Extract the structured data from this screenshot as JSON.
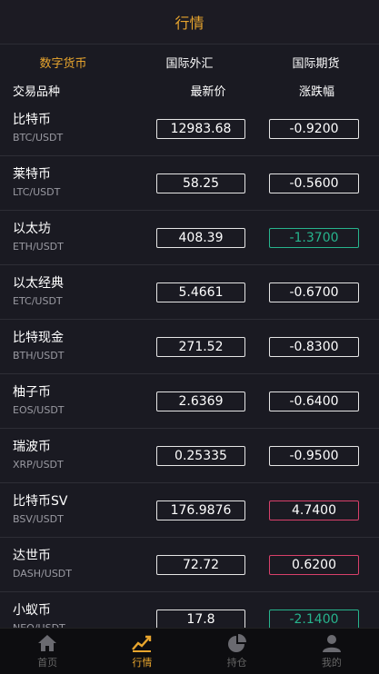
{
  "header": {
    "title": "行情"
  },
  "tabs": [
    {
      "label": "数字货币",
      "active": true
    },
    {
      "label": "国际外汇",
      "active": false
    },
    {
      "label": "国际期货",
      "active": false
    }
  ],
  "columns": {
    "name": "交易品种",
    "price": "最新价",
    "change": "涨跌幅"
  },
  "rows": [
    {
      "name": "比特币",
      "pair": "BTC/USDT",
      "price": "12983.68",
      "change": "-0.9200",
      "trend": "flat"
    },
    {
      "name": "莱特币",
      "pair": "LTC/USDT",
      "price": "58.25",
      "change": "-0.5600",
      "trend": "flat"
    },
    {
      "name": "以太坊",
      "pair": "ETH/USDT",
      "price": "408.39",
      "change": "-1.3700",
      "trend": "down"
    },
    {
      "name": "以太经典",
      "pair": "ETC/USDT",
      "price": "5.4661",
      "change": "-0.6700",
      "trend": "flat"
    },
    {
      "name": "比特现金",
      "pair": "BTH/USDT",
      "price": "271.52",
      "change": "-0.8300",
      "trend": "flat"
    },
    {
      "name": "柚子币",
      "pair": "EOS/USDT",
      "price": "2.6369",
      "change": "-0.6400",
      "trend": "flat"
    },
    {
      "name": "瑞波币",
      "pair": "XRP/USDT",
      "price": "0.25335",
      "change": "-0.9500",
      "trend": "flat"
    },
    {
      "name": "比特币SV",
      "pair": "BSV/USDT",
      "price": "176.9876",
      "change": "4.7400",
      "trend": "up"
    },
    {
      "name": "达世币",
      "pair": "DASH/USDT",
      "price": "72.72",
      "change": "0.6200",
      "trend": "up"
    },
    {
      "name": "小蚁币",
      "pair": "NEO/USDT",
      "price": "17.8",
      "change": "-2.1400",
      "trend": "down"
    }
  ],
  "bottom_nav": [
    {
      "label": "首页",
      "icon": "home-icon",
      "active": false
    },
    {
      "label": "行情",
      "icon": "chart-icon",
      "active": true
    },
    {
      "label": "持仓",
      "icon": "pie-icon",
      "active": false
    },
    {
      "label": "我的",
      "icon": "user-icon",
      "active": false
    }
  ],
  "colors": {
    "accent": "#e8a52e",
    "up": "#d8406a",
    "down": "#27b48d",
    "background": "#1a1a22"
  }
}
